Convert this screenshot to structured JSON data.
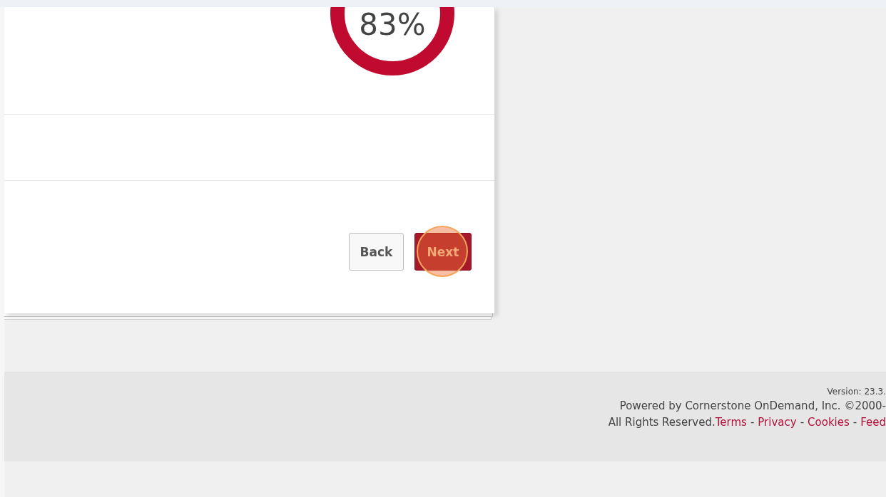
{
  "progress": {
    "label": "83%"
  },
  "buttons": [
    {
      "label": "Back",
      "kind": "secondary"
    },
    {
      "label": "Next",
      "kind": "primary",
      "highlighted": true
    }
  ],
  "footer": {
    "version": "Version: 23.3.",
    "copyright": "Powered by Cornerstone OnDemand, Inc. ©2000-",
    "rights": "All Rights Reserved.",
    "links": [
      "Terms",
      "Privacy",
      "Cookies",
      "Feed"
    ],
    "separators": [
      "-",
      "-",
      "-"
    ]
  }
}
